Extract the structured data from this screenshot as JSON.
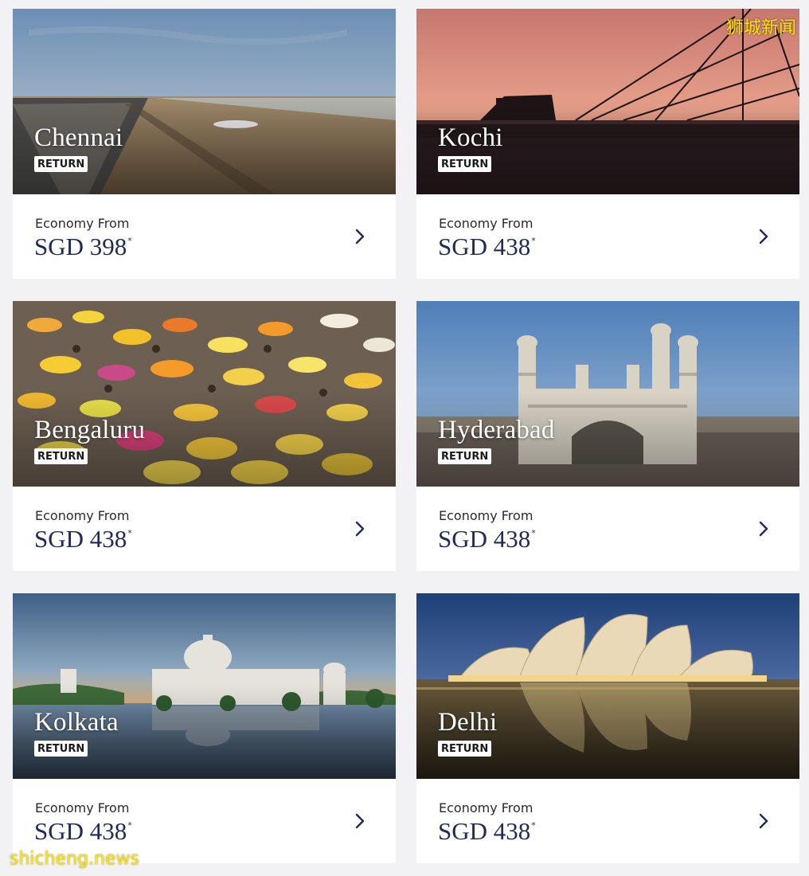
{
  "destinations": [
    {
      "city": "Chennai",
      "tag": "RETURN",
      "cabin_label": "Economy From",
      "price": "SGD 398",
      "price_mark": "*"
    },
    {
      "city": "Kochi",
      "tag": "RETURN",
      "cabin_label": "Economy From",
      "price": "SGD 438",
      "price_mark": "*"
    },
    {
      "city": "Bengaluru",
      "tag": "RETURN",
      "cabin_label": "Economy From",
      "price": "SGD 438",
      "price_mark": "*"
    },
    {
      "city": "Hyderabad",
      "tag": "RETURN",
      "cabin_label": "Economy From",
      "price": "SGD 438",
      "price_mark": "*"
    },
    {
      "city": "Kolkata",
      "tag": "RETURN",
      "cabin_label": "Economy From",
      "price": "SGD 438",
      "price_mark": "*"
    },
    {
      "city": "Delhi",
      "tag": "RETURN",
      "cabin_label": "Economy From",
      "price": "SGD 438",
      "price_mark": "*"
    }
  ],
  "watermarks": {
    "top_right": "狮城新闻",
    "bottom_left": "shicheng.news"
  },
  "colors": {
    "price": "#1f2a55",
    "background": "#f2f2f4",
    "watermark": "#ffe600"
  },
  "icons": {
    "card_arrow": "chevron-right-icon"
  }
}
